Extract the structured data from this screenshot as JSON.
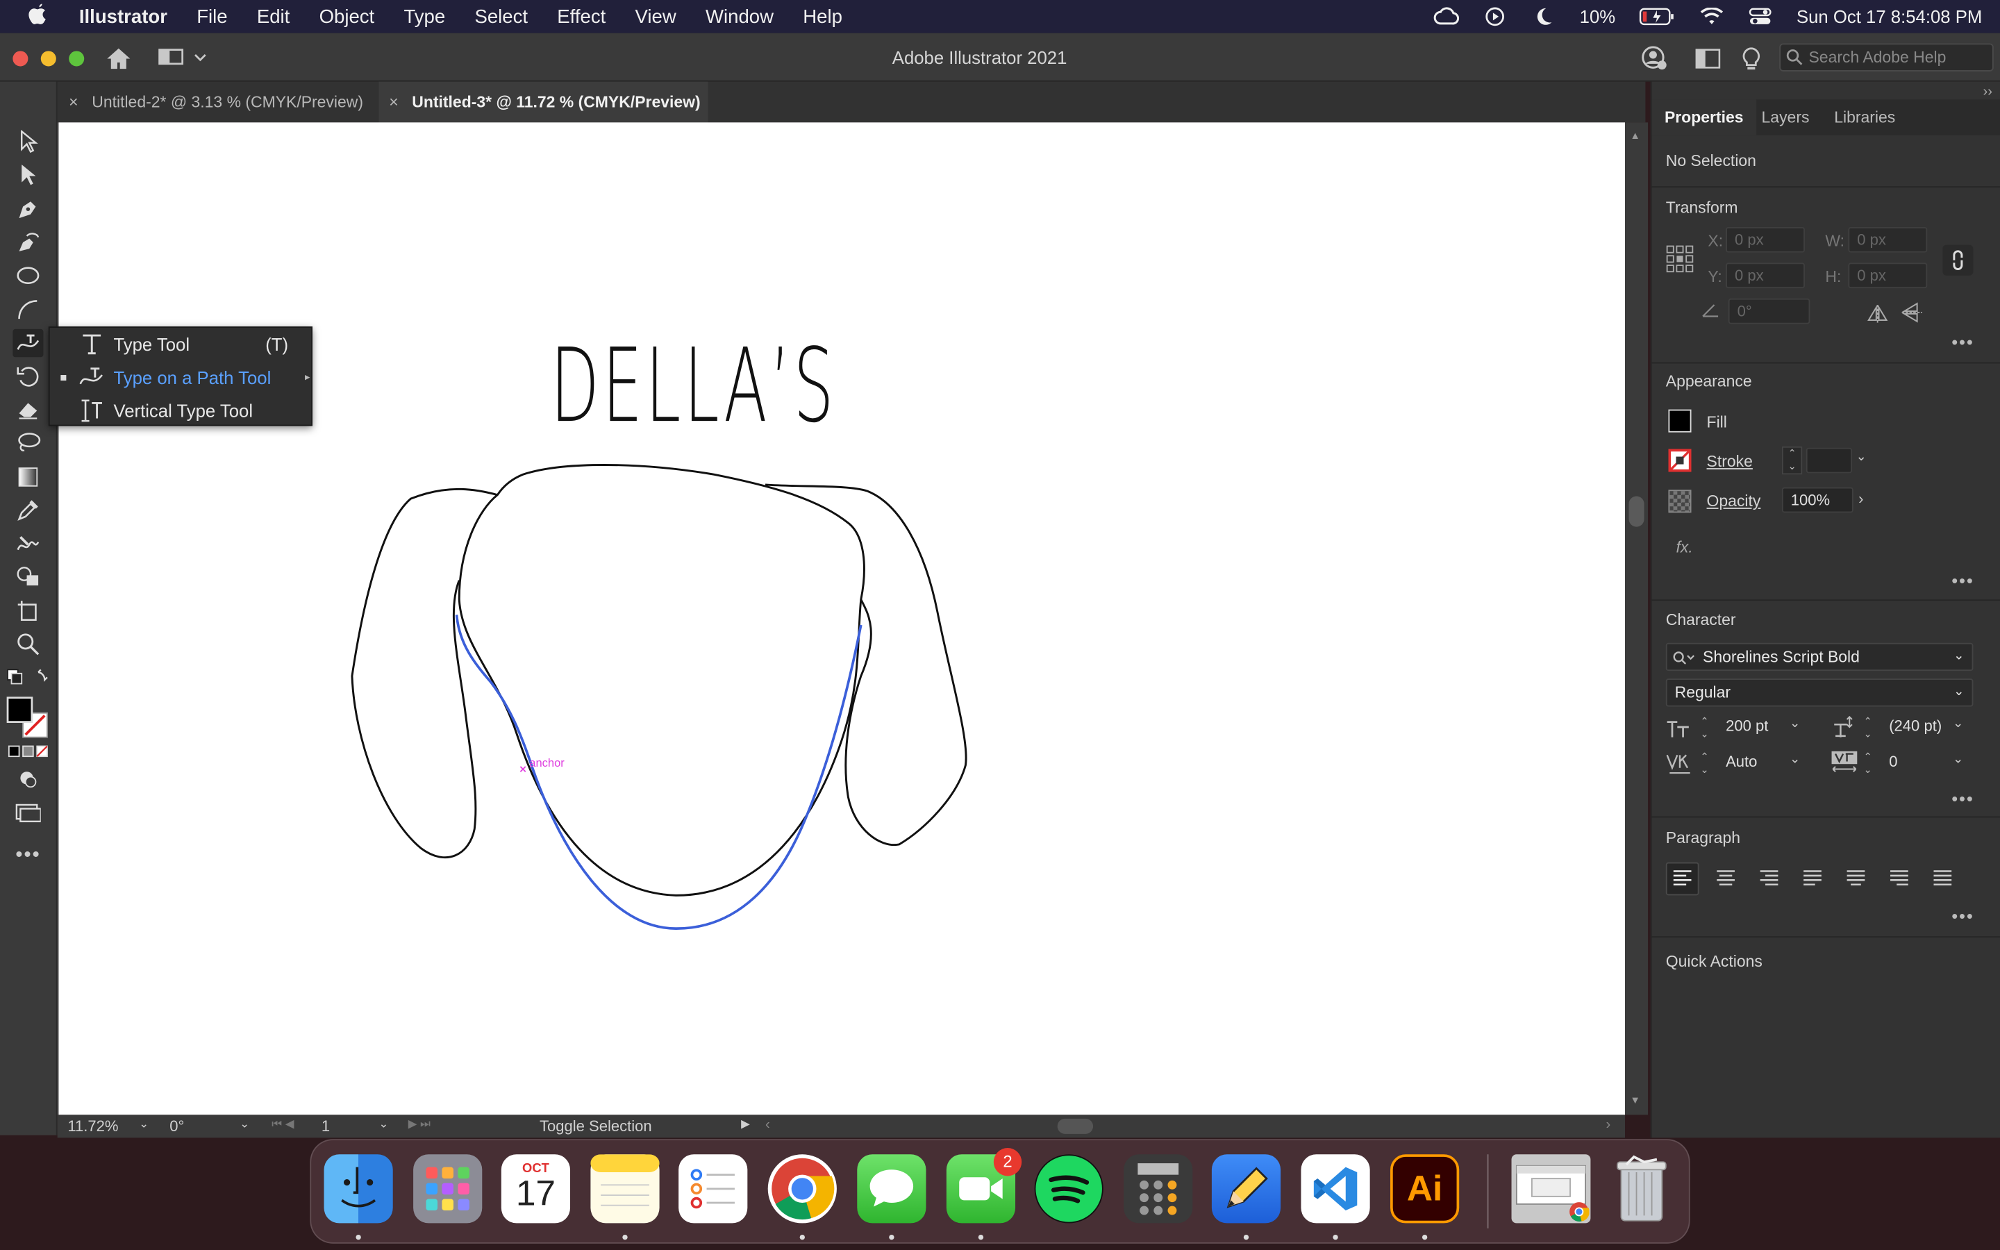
{
  "menubar": {
    "app_name": "Illustrator",
    "items": [
      "File",
      "Edit",
      "Object",
      "Type",
      "Select",
      "Effect",
      "View",
      "Window",
      "Help"
    ],
    "battery": "10%",
    "datetime": "Sun Oct 17  8:54:08 PM"
  },
  "window": {
    "title": "Adobe Illustrator 2021",
    "search_placeholder": "Search Adobe Help"
  },
  "tabs": [
    {
      "label": "Untitled-2* @ 3.13 % (CMYK/Preview)",
      "active": false
    },
    {
      "label": "Untitled-3* @ 11.72 % (CMYK/Preview)",
      "active": true
    }
  ],
  "flyout": {
    "items": [
      {
        "label": "Type Tool",
        "shortcut": "(T)"
      },
      {
        "label": "Type on a Path Tool",
        "shortcut": ""
      },
      {
        "label": "Vertical Type Tool",
        "shortcut": ""
      }
    ]
  },
  "artboard": {
    "heading": "DELLA’S",
    "anchor_hint": "anchor"
  },
  "status": {
    "zoom": "11.72%",
    "rotation": "0°",
    "artboard_number": "1",
    "mode": "Toggle Selection"
  },
  "panel": {
    "tabs": [
      "Properties",
      "Layers",
      "Libraries"
    ],
    "selection": "No Selection",
    "transform": {
      "title": "Transform",
      "x_label": "X:",
      "x_value": "0 px",
      "y_label": "Y:",
      "y_value": "0 px",
      "w_label": "W:",
      "w_value": "0 px",
      "h_label": "H:",
      "h_value": "0 px",
      "angle_value": "0°"
    },
    "appearance": {
      "title": "Appearance",
      "fill": "Fill",
      "stroke": "Stroke",
      "opacity": "Opacity",
      "opacity_value": "100%",
      "fx": "fx."
    },
    "character": {
      "title": "Character",
      "font": "Shorelines Script Bold",
      "style": "Regular",
      "size": "200 pt",
      "leading": "(240 pt)",
      "kerning": "Auto",
      "tracking": "0"
    },
    "paragraph": {
      "title": "Paragraph"
    },
    "quick_actions": {
      "title": "Quick Actions"
    }
  },
  "dock": {
    "calendar_month": "OCT",
    "calendar_day": "17",
    "facetime_badge": "2",
    "illustrator_label": "Ai"
  },
  "colors": {
    "menubar_bg": "#21203a",
    "chrome_bg": "#3a3a3a",
    "panel_bg": "#333333",
    "accent_blue": "#5aa0ff",
    "path_blue": "#3b5fd9",
    "anchor_magenta": "#e040e0"
  }
}
